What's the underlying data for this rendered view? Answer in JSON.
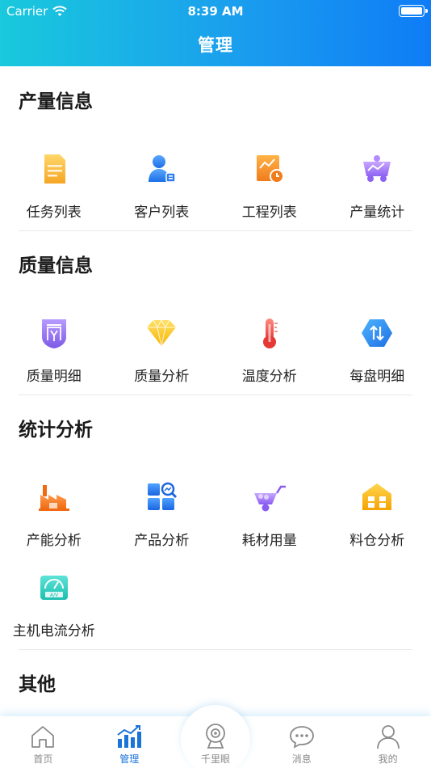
{
  "status": {
    "carrier": "Carrier",
    "time": "8:39 AM"
  },
  "nav": {
    "title": "管理"
  },
  "sections": [
    {
      "title": "产量信息",
      "items": [
        {
          "label": "任务列表",
          "icon": "task-list-icon"
        },
        {
          "label": "客户列表",
          "icon": "customer-list-icon"
        },
        {
          "label": "工程列表",
          "icon": "project-list-icon"
        },
        {
          "label": "产量统计",
          "icon": "output-stats-icon"
        }
      ]
    },
    {
      "title": "质量信息",
      "items": [
        {
          "label": "质量明细",
          "icon": "quality-detail-icon"
        },
        {
          "label": "质量分析",
          "icon": "quality-analysis-icon"
        },
        {
          "label": "温度分析",
          "icon": "thermometer-icon"
        },
        {
          "label": "每盘明细",
          "icon": "batch-detail-icon"
        }
      ]
    },
    {
      "title": "统计分析",
      "items": [
        {
          "label": "产能分析",
          "icon": "factory-icon"
        },
        {
          "label": "产品分析",
          "icon": "product-analysis-icon"
        },
        {
          "label": "耗材用量",
          "icon": "wheelbarrow-icon"
        },
        {
          "label": "料仓分析",
          "icon": "warehouse-icon"
        },
        {
          "label": "主机电流分析",
          "icon": "ammeter-icon"
        }
      ]
    },
    {
      "title": "其他",
      "items": []
    }
  ],
  "tabbar": {
    "items": [
      {
        "label": "首页",
        "icon": "home-icon"
      },
      {
        "label": "管理",
        "icon": "chart-icon"
      },
      {
        "label": "千里眼",
        "icon": "camera-icon"
      },
      {
        "label": "消息",
        "icon": "message-icon"
      },
      {
        "label": "我的",
        "icon": "profile-icon"
      }
    ]
  },
  "colors": {
    "header_start": "#19c9dc",
    "header_end": "#0f7cf6",
    "active_tab": "#1a74d8",
    "inactive_tab": "#8a8a8a"
  }
}
